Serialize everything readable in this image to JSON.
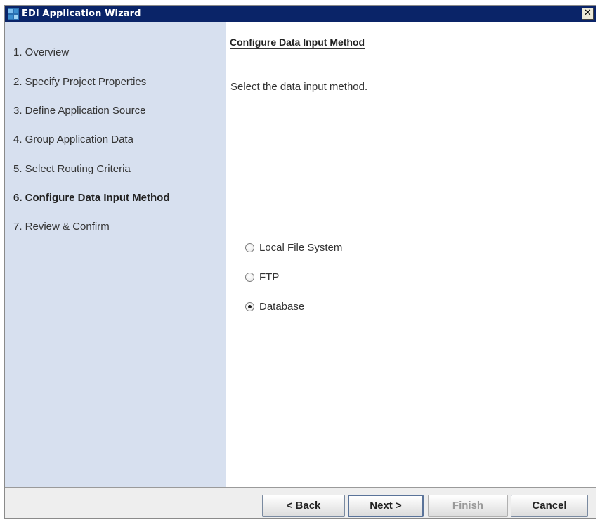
{
  "window": {
    "title": "EDI Application Wizard",
    "close_glyph": "✕"
  },
  "steps": [
    {
      "label": "1. Overview",
      "active": false
    },
    {
      "label": "2. Specify Project Properties",
      "active": false
    },
    {
      "label": "3. Define Application Source",
      "active": false
    },
    {
      "label": "4. Group Application Data",
      "active": false
    },
    {
      "label": "5. Select Routing Criteria",
      "active": false
    },
    {
      "label": "6. Configure Data Input Method",
      "active": true
    },
    {
      "label": "7. Review & Confirm",
      "active": false
    }
  ],
  "content": {
    "title": "Configure Data Input Method",
    "description": "Select the data input method.",
    "options": [
      {
        "label": "Local File System",
        "selected": false
      },
      {
        "label": "FTP",
        "selected": false
      },
      {
        "label": "Database",
        "selected": true
      }
    ]
  },
  "buttons": {
    "back": "< Back",
    "next": "Next >",
    "finish": "Finish",
    "cancel": "Cancel"
  },
  "colors": {
    "titlebar": "#0a2468",
    "steps_panel": "#d7e0ef",
    "content_bg": "#ffffff"
  }
}
